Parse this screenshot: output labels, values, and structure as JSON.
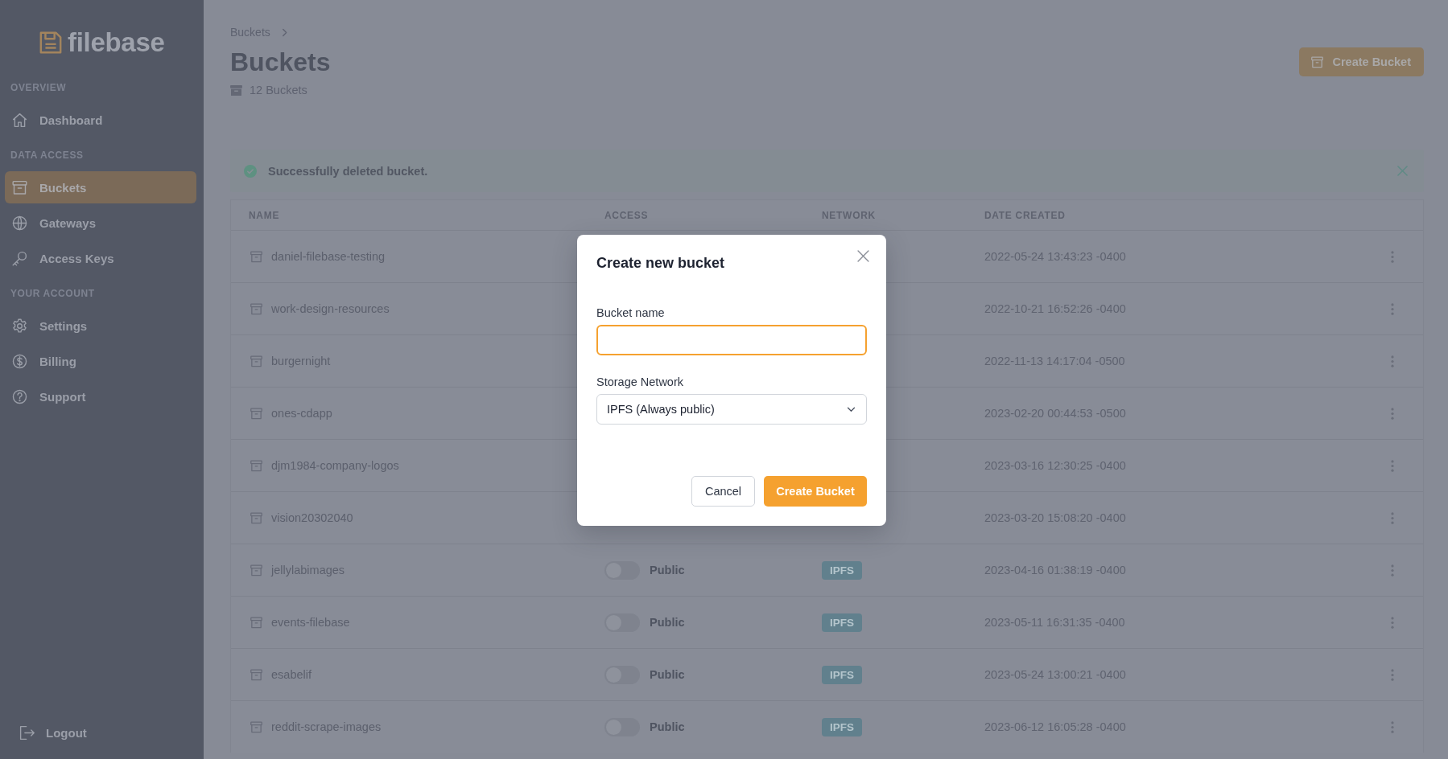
{
  "sidebar": {
    "logo": {
      "text": "filebase"
    },
    "sections": [
      {
        "heading": "OVERVIEW",
        "items": [
          {
            "label": "Dashboard",
            "selected": false
          }
        ]
      },
      {
        "heading": "DATA ACCESS",
        "items": [
          {
            "label": "Buckets",
            "selected": true
          },
          {
            "label": "Gateways",
            "selected": false
          },
          {
            "label": "Access Keys",
            "selected": false
          }
        ]
      },
      {
        "heading": "YOUR ACCOUNT",
        "items": [
          {
            "label": "Settings",
            "selected": false
          },
          {
            "label": "Billing",
            "selected": false
          },
          {
            "label": "Support",
            "selected": false
          }
        ]
      }
    ],
    "logout": {
      "label": "Logout"
    }
  },
  "header": {
    "breadcrumb": [
      {
        "label": "Buckets"
      }
    ],
    "title": "Buckets",
    "count": "12 Buckets",
    "action": {
      "label": "Create Bucket"
    }
  },
  "alert": {
    "kind": "success",
    "message": "Successfully deleted bucket."
  },
  "table": {
    "columns": [
      "NAME",
      "ACCESS",
      "NETWORK",
      "DATE CREATED"
    ],
    "rows": [
      {
        "name": "daniel-filebase-testing",
        "date_created": "2022-05-24 13:43:23 -0400"
      },
      {
        "name": "work-design-resources",
        "date_created": "2022-10-21 16:52:26 -0400"
      },
      {
        "name": "burgernight",
        "date_created": "2022-11-13 14:17:04 -0500"
      },
      {
        "name": "ones-cdapp",
        "date_created": "2023-02-20 00:44:53 -0500"
      },
      {
        "name": "djm1984-company-logos",
        "date_created": "2023-03-16 12:30:25 -0400"
      },
      {
        "name": "vision20302040",
        "date_created": "2023-03-20 15:08:20 -0400"
      },
      {
        "name": "jellylabimages",
        "access": {
          "on": false,
          "label": "Public"
        },
        "network": "IPFS",
        "date_created": "2023-04-16 01:38:19 -0400"
      },
      {
        "name": "events-filebase",
        "access": {
          "on": false,
          "label": "Public"
        },
        "network": "IPFS",
        "date_created": "2023-05-11 16:31:35 -0400"
      },
      {
        "name": "esabelif",
        "access": {
          "on": false,
          "label": "Public"
        },
        "network": "IPFS",
        "date_created": "2023-05-24 13:00:21 -0400"
      },
      {
        "name": "reddit-scrape-images",
        "access": {
          "on": false,
          "label": "Public"
        },
        "network": "IPFS",
        "date_created": "2023-06-12 16:05:28 -0400"
      }
    ]
  },
  "modal": {
    "title": "Create new bucket",
    "fields": [
      {
        "kind": "text",
        "label": "Bucket name",
        "focused": true
      },
      {
        "kind": "select",
        "label": "Storage Network",
        "value": "IPFS (Always public)"
      }
    ],
    "buttons": [
      {
        "kind": "secondary",
        "label": "Cancel"
      },
      {
        "kind": "primary",
        "label": "Create Bucket"
      }
    ]
  }
}
